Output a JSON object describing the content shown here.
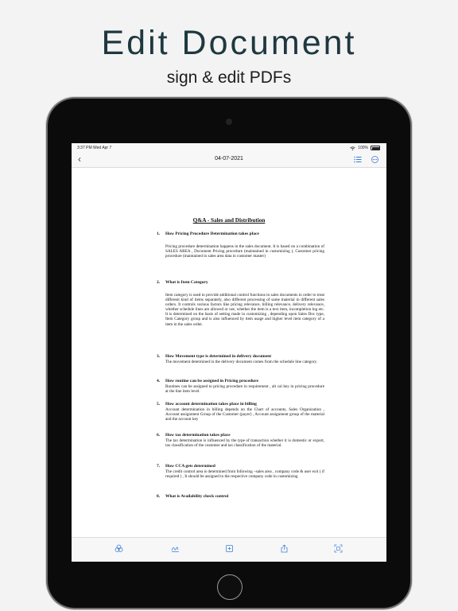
{
  "marketing": {
    "headline": "Edit Document",
    "subline": "sign & edit PDFs"
  },
  "status_bar": {
    "time_date": "3:37 PM   Wed Apr 7",
    "battery": "100%"
  },
  "nav": {
    "title": "04-07-2021",
    "back_icon": "chevron-left-icon",
    "right_icons": [
      "list-icon",
      "more-circle-icon"
    ]
  },
  "accent_color": "#3a7bd5",
  "document": {
    "title": "Q&A - Sales and Distribution",
    "sections": [
      {
        "num": "1.",
        "q": "How Pricing Procedure Determination takes place",
        "a": "Pricing procedure determination happens in the sales document. It is based on a combination of SALES AREA , Document Pricing procedure (maintained in customizing ), Customer pricing procedure (maintained in sales area data in customer master)"
      },
      {
        "num": "2.",
        "q": "What is Item Category",
        "a": "Item category is used to provide additional control functions in sales documents in order to treat different kind of items separately, also different processing of same material in different sales orders. It controls various factors like pricing relevance, billing relevance, delivery relevance, whether schedule lines are allowed or not, whether the item is a text item, incompletion log etc. It is determined on the basis of setting made in customizing , depending upon Sales Doc type, Item Category group and is also influenced by item usage and higher level item category of a item in the sales order."
      },
      {
        "num": "3.",
        "q": "How Movement type is determined in delivery document",
        "a": "The movement determined in the delivery document comes from the schedule line category."
      },
      {
        "num": "4.",
        "q": "How routine can be assigned in Pricing procedure",
        "a": "Routines can be assigned to pricing procedure in requirement , alt cal key in pricing procedure at the line item level."
      },
      {
        "num": "5.",
        "q": "How account determination takes place in billing",
        "a": "Account determination in billing depends on the Chart of accounts, Sales Organization , Account assignment Group of the Customer (payer) , Account assignment group of the material and the account key"
      },
      {
        "num": "6.",
        "q": "How tax determination takes place",
        "a": "The tax determination is influenced by the type of transaction whether it is domestic or export, tax classification of the customer and tax classification of the material."
      },
      {
        "num": "7.",
        "q": "How CCA gets determined",
        "a": "The credit control area is determined from following –sales area , company code & user exit ( if required ) , It should be assigned to the respective company code in customizing"
      },
      {
        "num": "8.",
        "q": "What is Availability check control",
        "a": ""
      }
    ]
  },
  "toolbar": {
    "icons": [
      "circles-icon",
      "signature-icon",
      "add-square-icon",
      "share-icon",
      "scan-icon"
    ]
  }
}
